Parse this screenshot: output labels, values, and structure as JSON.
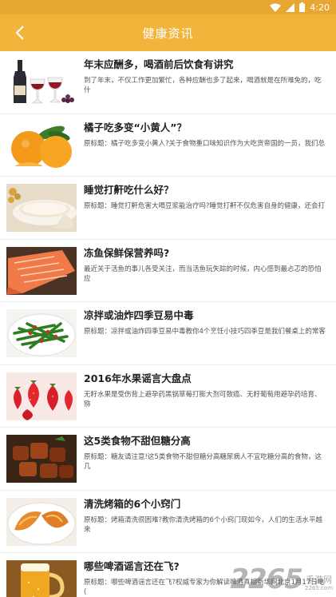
{
  "statusbar": {
    "time": "4:20"
  },
  "header": {
    "title": "健康资讯"
  },
  "articles": [
    {
      "title": "年末应酬多，喝酒前后饮食有讲究",
      "desc": "到了年末，不仅工作更加繁忙，各种应酬也多了起来，喝酒就是在所难免的，吃什"
    },
    {
      "title": "橘子吃多变“小黄人”？",
      "desc": "原标题：橘子吃多变小黄人?关于食物重口味知识作为大吃货帝国的一员，我们总"
    },
    {
      "title": "睡觉打鼾吃什么好？",
      "desc": "原标题：睡觉打鼾危害大喝豆浆能治疗吗?睡觉打鼾不仅危害自身的健康，还会打"
    },
    {
      "title": "冻鱼保鲜保营养吗?",
      "desc": "最近关于活鱼的事儿各受关注，而当活鱼玩失踪的时候，内心感到最忐忑的恐怕应"
    },
    {
      "title": "凉拌或油炸四季豆易中毒",
      "desc": "原标题：凉拌或油炸四季豆易中毒教你4个烹饪小技巧四季豆是我们餐桌上的常客"
    },
    {
      "title": "2016年水果谣言大盘点",
      "desc": "无籽水果是受伤背上避孕药黑锅草莓打膨大剂可致癌、无籽葡萄用避孕药培育、猕"
    },
    {
      "title": "这5类食物不甜但糖分高",
      "desc": "原标题：糖友请注意!这5类食物不甜但糖分高糖尿病人不宜吃糖分高的食物，这几"
    },
    {
      "title": "清洗烤箱的6个小窍门",
      "desc": "原标题：烤箱清洗很困难?教你清洗烤箱的6个小窍门现如今，人们的生活水平越来"
    },
    {
      "title": "哪些啤酒谣言还在飞?",
      "desc": "原标题：哪些啤酒谣言还在飞?权威专家为你解读啤酒真相新华网北京1月17日电("
    }
  ],
  "watermark": {
    "brand": "2265",
    "cn": "手游网",
    "url": "2265.com"
  }
}
